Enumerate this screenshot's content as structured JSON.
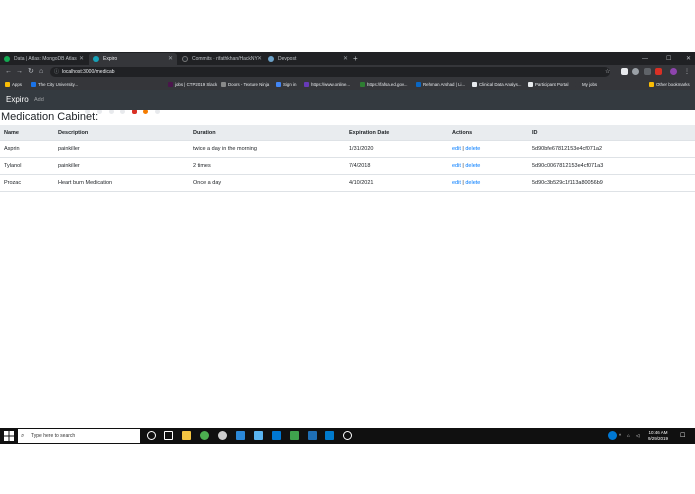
{
  "tabs": [
    {
      "title": "Data | Atlas: MongoDB Atlas",
      "active": false,
      "color": "#13aa52"
    },
    {
      "title": "Expiro",
      "active": true,
      "color": "#17a2b8"
    },
    {
      "title": "Commits · rifathkhan/HackNY",
      "active": false,
      "color": "#24292e"
    },
    {
      "title": "Devpost",
      "active": false,
      "color": "#6ca1c8"
    }
  ],
  "address": {
    "url": "localhost:3000/medicab"
  },
  "bookmarks": [
    "Apps",
    "The City University...",
    "jobs | CTP2019 Slack",
    "Doors - Texture Ninja",
    "Sign in",
    "https://www.online...",
    "https://fafsa.ed.gov...",
    "Rehman Arshad | Li...",
    "Clinical Data Analys...",
    "Participant Portal",
    "My jobs",
    "Other bookmarks"
  ],
  "navbar": {
    "brand": "Expiro",
    "add_link": "Add"
  },
  "page": {
    "title": "Medication Cabinet:"
  },
  "table": {
    "headers": [
      "Name",
      "Description",
      "Duration",
      "Expiration Date",
      "Actions",
      "ID"
    ],
    "rows": [
      {
        "name": "Asprin",
        "description": "painkiller",
        "duration": "twice a day in the morning",
        "expiration": "1/31/2020",
        "edit": "edit",
        "sep": "|",
        "delete": "delete",
        "id": "5d90bfe67812153e4cf071a2"
      },
      {
        "name": "Tylanol",
        "description": "painkiller",
        "duration": "2 times",
        "expiration": "7/4/2018",
        "edit": "edit",
        "sep": "|",
        "delete": "delete",
        "id": "5d90c0067812153e4cf071a3"
      },
      {
        "name": "Prozac",
        "description": "Heart burn Medication",
        "duration": "Once a day",
        "expiration": "4/10/2021",
        "edit": "edit",
        "sep": "|",
        "delete": "delete",
        "id": "5d90c3b529c1f113a80056b9"
      }
    ]
  },
  "taskbar": {
    "search_placeholder": "Type here to search",
    "time": "10:46 AM",
    "date": "9/29/2019"
  },
  "colors": {
    "accent_link": "#007bff",
    "navbar_bg": "#343a40",
    "browser_dark": "#202124"
  }
}
